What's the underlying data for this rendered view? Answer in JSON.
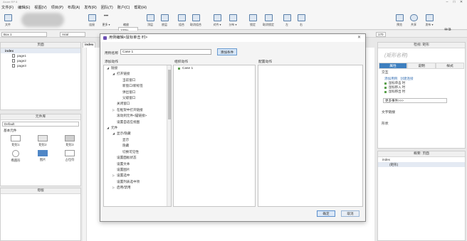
{
  "app": {
    "title": "Axure RP 8"
  },
  "menu": [
    "文件(F)",
    "编辑(E)",
    "视图(V)",
    "项目(P)",
    "布局(A)",
    "发布(R)",
    "团队(T)",
    "账户(C)",
    "帮助(H)"
  ],
  "toolbar": {
    "file_label": "文件",
    "connect_label": "连接",
    "more_label": "更多 ▾",
    "zoom_value": "100%",
    "zoom_label": "缩放",
    "top_label": "顶层",
    "bottom_label": "底层",
    "combine_label": "组合",
    "ungroup_label": "取消组合",
    "align_label": "对齐 ▾",
    "distribute_label": "分布 ▾",
    "lock_label": "锁定",
    "unlock_label": "取消锁定",
    "left_label": "左",
    "right_label": "右",
    "preview_label": "预览",
    "share_label": "共享",
    "publish_label": "发布 ▾",
    "login_label": "登录"
  },
  "formatbar": {
    "widget": "Box 1",
    "font": "Arial",
    "size": "170"
  },
  "pages": {
    "title": "页面",
    "root": "index",
    "items": [
      "page1",
      "page2",
      "page3"
    ]
  },
  "library": {
    "title": "元件库",
    "selected": "Default",
    "group": "基本元件",
    "widgets": [
      "矩形1",
      "矩形2",
      "矩形3",
      "椭圆形",
      "图片",
      "占位符"
    ]
  },
  "masters": {
    "title": "母版"
  },
  "canvas": {
    "tab": "index"
  },
  "inspector": {
    "title": "检视: 矩形",
    "shape_name_placeholder": "(矩形名称)",
    "tabs": [
      "属性",
      "说明",
      "样式"
    ],
    "interaction": "交互",
    "add_case": "添加用例",
    "create_link": "创建连接",
    "events": [
      "鼠标单击 时",
      "鼠标移入 时",
      "鼠标移出 时"
    ],
    "more_events": "更多事件>>>",
    "text_link": "文字链接",
    "shape": "形状"
  },
  "outline": {
    "title": "概要: 页面",
    "root": "index",
    "child": "(矩形)"
  },
  "dialog": {
    "title": "用例编辑<鼠标单击 时>",
    "case_name_label": "用例名称",
    "case_name_value": "Case 1",
    "add_condition": "添加条件",
    "add_action_title": "添加动作",
    "organize_title": "组织动作",
    "configure_title": "配置动作",
    "actions": [
      {
        "label": "链接",
        "level": 0,
        "tri": "◢"
      },
      {
        "label": "打开链接",
        "level": 1,
        "tri": "◢"
      },
      {
        "label": "当前窗口",
        "level": 2,
        "tri": ""
      },
      {
        "label": "新窗口/新标签",
        "level": 2,
        "tri": ""
      },
      {
        "label": "弹出窗口",
        "level": 2,
        "tri": ""
      },
      {
        "label": "父级窗口",
        "level": 2,
        "tri": ""
      },
      {
        "label": "关闭窗口",
        "level": 1,
        "tri": ""
      },
      {
        "label": "在框架中打开链接",
        "level": 1,
        "tri": "▷"
      },
      {
        "label": "滚动到元件<锚链接>",
        "level": 1,
        "tri": ""
      },
      {
        "label": "设置自适应视图",
        "level": 1,
        "tri": ""
      },
      {
        "label": "元件",
        "level": 0,
        "tri": "◢"
      },
      {
        "label": "显示/隐藏",
        "level": 1,
        "tri": "◢"
      },
      {
        "label": "显示",
        "level": 2,
        "tri": ""
      },
      {
        "label": "隐藏",
        "level": 2,
        "tri": ""
      },
      {
        "label": "切换可见性",
        "level": 2,
        "tri": ""
      },
      {
        "label": "设置面板状态",
        "level": 1,
        "tri": ""
      },
      {
        "label": "设置文本",
        "level": 1,
        "tri": ""
      },
      {
        "label": "设置图片",
        "level": 1,
        "tri": ""
      },
      {
        "label": "设置选中",
        "level": 1,
        "tri": "▷"
      },
      {
        "label": "设置列表选中项",
        "level": 1,
        "tri": ""
      },
      {
        "label": "启用/禁用",
        "level": 1,
        "tri": "▷"
      }
    ],
    "case": "Case 1",
    "ok": "确定",
    "cancel": "取消"
  }
}
